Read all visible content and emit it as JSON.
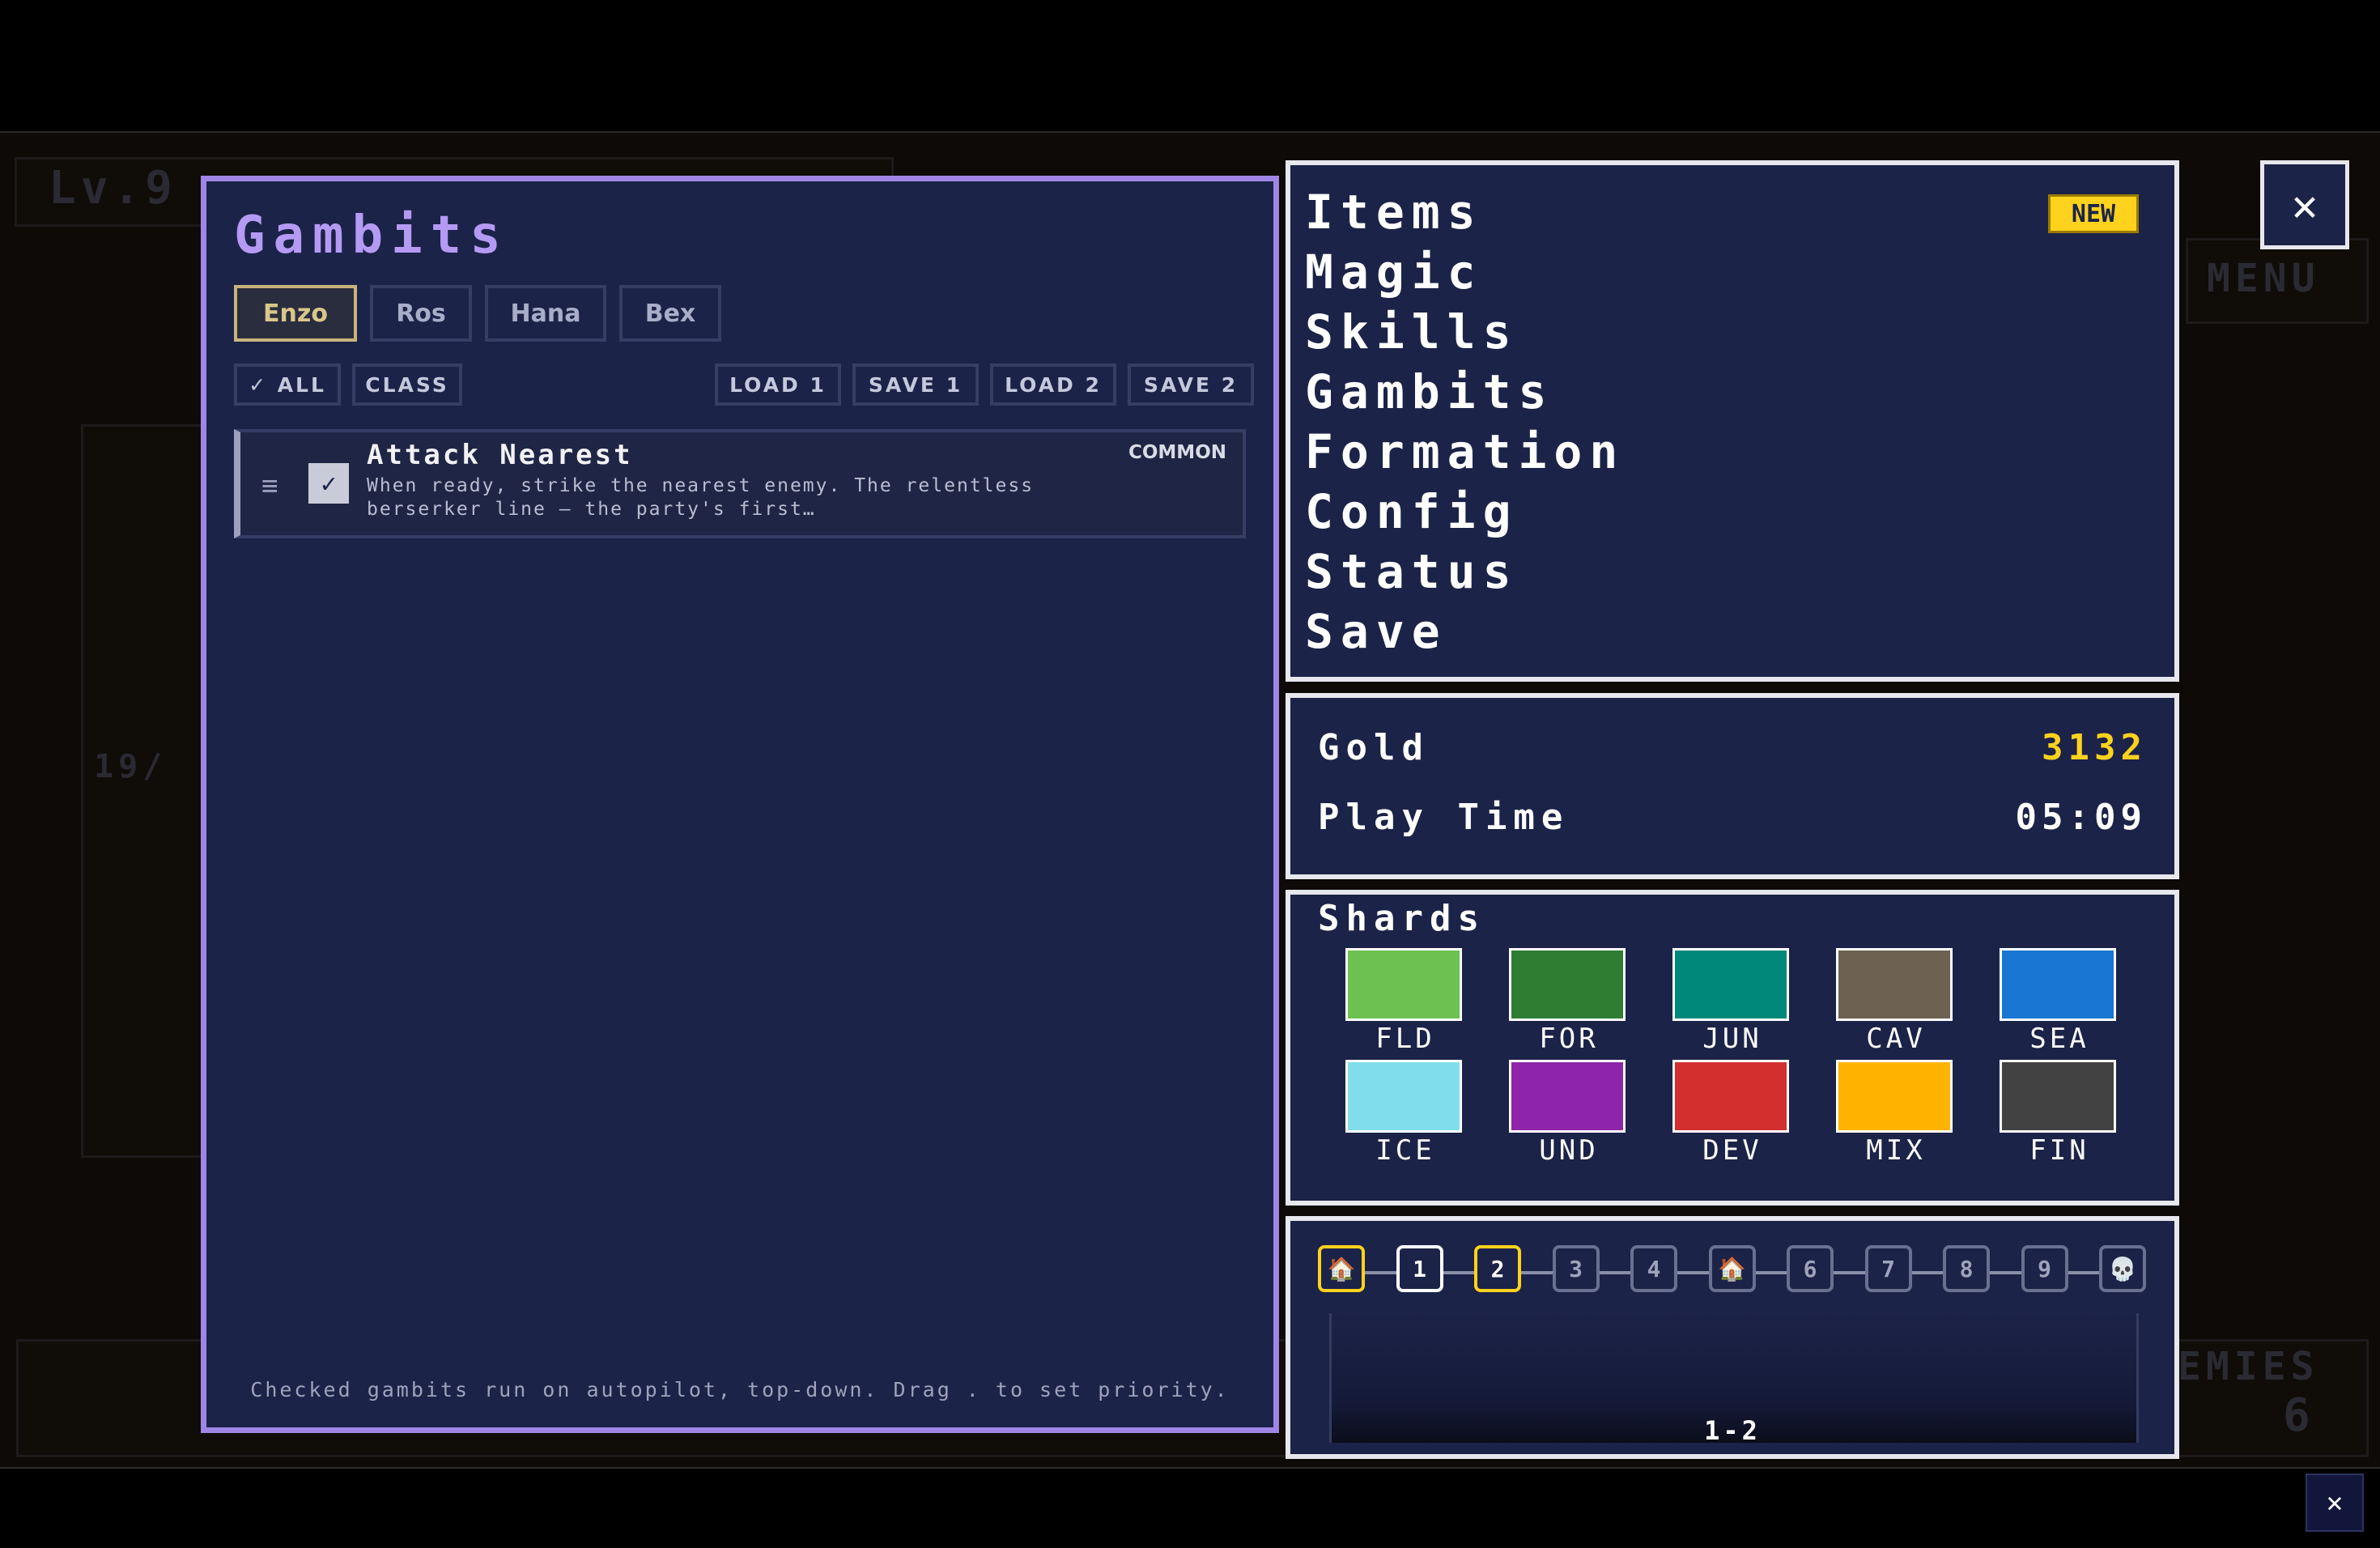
{
  "background": {
    "level_text": "Lv.9",
    "menu_text": "MENU",
    "hp_text": "19/",
    "enemies_text": "EMIES",
    "enemies_count": "6"
  },
  "gambits_panel": {
    "title": "Gambits",
    "tabs": [
      {
        "label": "Enzo",
        "active": true
      },
      {
        "label": "Ros",
        "active": false
      },
      {
        "label": "Hana",
        "active": false
      },
      {
        "label": "Bex",
        "active": false
      }
    ],
    "filters": {
      "all": "✓ ALL",
      "class": "CLASS"
    },
    "actions": {
      "load1": "LOAD 1",
      "save1": "SAVE 1",
      "load2": "LOAD 2",
      "save2": "SAVE 2"
    },
    "gambits": [
      {
        "name": "Attack Nearest",
        "description": "When ready, strike the nearest enemy. The relentless berserker line — the party's first…",
        "rarity": "COMMON",
        "checked": true,
        "check_glyph": "✓",
        "handle_glyph": "≡"
      }
    ],
    "footer": "Checked gambits run on autopilot, top-down. Drag . to set priority."
  },
  "menu": {
    "items": [
      "Items",
      "Magic",
      "Skills",
      "Gambits",
      "Formation",
      "Config",
      "Status",
      "Save"
    ],
    "new_badge": "NEW"
  },
  "close_glyph": "✕",
  "stats": {
    "gold_label": "Gold",
    "gold_value": "3132",
    "gold_color": "#ffd21d",
    "playtime_label": "Play Time",
    "playtime_value": "05:09"
  },
  "shards": {
    "title": "Shards",
    "items": [
      {
        "label": "FLD",
        "color": "#6dc150"
      },
      {
        "label": "FOR",
        "color": "#2e7d32"
      },
      {
        "label": "JUN",
        "color": "#00897b"
      },
      {
        "label": "CAV",
        "color": "#6d6152"
      },
      {
        "label": "SEA",
        "color": "#1976d2"
      },
      {
        "label": "ICE",
        "color": "#80deea"
      },
      {
        "label": "UND",
        "color": "#8e24aa"
      },
      {
        "label": "DEV",
        "color": "#d32f2f"
      },
      {
        "label": "MIX",
        "color": "#ffb300"
      },
      {
        "label": "FIN",
        "color": "#424242"
      }
    ]
  },
  "map": {
    "nodes": [
      {
        "label": "🏠",
        "state": "home",
        "icon": "home-icon"
      },
      {
        "label": "1",
        "state": "cleared"
      },
      {
        "label": "2",
        "state": "current"
      },
      {
        "label": "3",
        "state": "locked"
      },
      {
        "label": "4",
        "state": "locked"
      },
      {
        "label": "🏠",
        "state": "town",
        "icon": "home-icon"
      },
      {
        "label": "6",
        "state": "locked"
      },
      {
        "label": "7",
        "state": "locked"
      },
      {
        "label": "8",
        "state": "locked"
      },
      {
        "label": "9",
        "state": "locked"
      },
      {
        "label": "💀",
        "state": "boss",
        "icon": "skull-icon"
      }
    ],
    "stage_label": "1-2"
  },
  "bottom_close_glyph": "✕"
}
